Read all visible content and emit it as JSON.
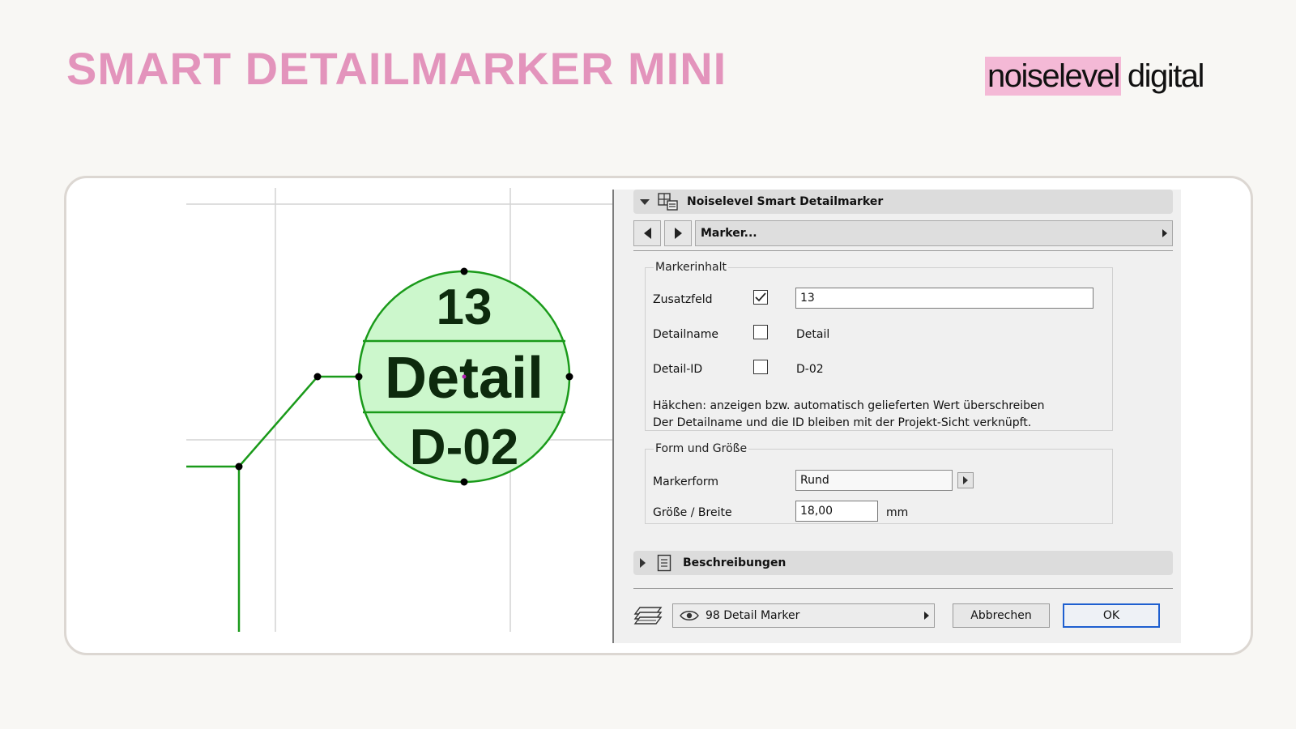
{
  "page": {
    "title": "SMART DETAILMARKER MINI",
    "logo_highlight": "noiselevel",
    "logo_rest": "digital",
    "accent_color": "#e394bc",
    "logo_highlight_color": "#f4b9d6"
  },
  "marker": {
    "line1": "13",
    "line2": "Detail",
    "line3": "D-02",
    "fill_color": "#ccf7cc",
    "stroke_color": "#1a9a1a",
    "text_color": "#0d2a0d"
  },
  "dialog": {
    "header": {
      "title": "Noiselevel Smart Detailmarker",
      "icon": "settings-grid-icon"
    },
    "nav": {
      "prev_icon": "triangle-left-icon",
      "next_icon": "triangle-right-icon",
      "page_label": "Marker..."
    },
    "content_group": {
      "legend": "Markerinhalt",
      "rows": [
        {
          "label": "Zusatzfeld",
          "checked": true,
          "value": "13"
        },
        {
          "label": "Detailname",
          "checked": false,
          "value": "Detail"
        },
        {
          "label": "Detail-ID",
          "checked": false,
          "value": "D-02"
        }
      ],
      "hint_line1": "Häkchen: anzeigen bzw. automatisch gelieferten Wert überschreiben",
      "hint_line2": "Der Detailname und die ID bleiben mit der Projekt-Sicht verknüpft."
    },
    "shape_group": {
      "legend": "Form und Größe",
      "shape_label": "Markerform",
      "shape_value": "Rund",
      "size_label": "Größe / Breite",
      "size_value": "18,00",
      "size_unit": "mm"
    },
    "descriptions": {
      "title": "Beschreibungen",
      "icon": "document-list-icon"
    },
    "footer": {
      "layer_icon": "layers-icon",
      "layer_value": "98 Detail Marker",
      "cancel_label": "Abbrechen",
      "ok_label": "OK"
    }
  }
}
